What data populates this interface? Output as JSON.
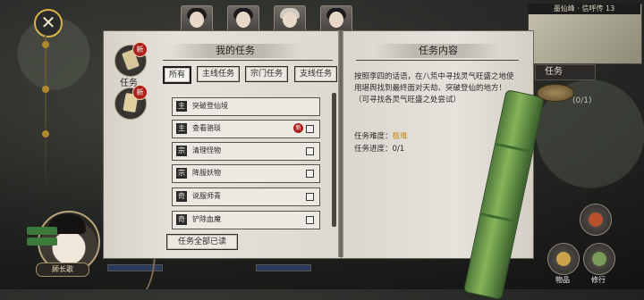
{
  "hud": {
    "close_glyph": "✕",
    "minimap_title": "墨仙峰 · 信呼传 13",
    "side_task_label": "任务",
    "side_text_1": "(0/1)",
    "bottom_buttons": [
      "物品",
      "修行"
    ],
    "player_name": "顾长歌"
  },
  "book": {
    "left": {
      "title": "我的任务",
      "side_tabs": [
        {
          "label": "任务",
          "badge": "新",
          "icon": "scroll-icon"
        },
        {
          "label": "",
          "badge": "新",
          "icon": "letter-icon"
        }
      ],
      "filters": [
        {
          "label": "所有",
          "active": true
        },
        {
          "label": "主线任务",
          "active": false
        },
        {
          "label": "宗门任务",
          "active": false
        },
        {
          "label": "支线任务",
          "active": false
        }
      ],
      "tasks": [
        {
          "type": "主",
          "name": "突破登仙境",
          "new": false,
          "checkbox": false
        },
        {
          "type": "主",
          "name": "查看骆琰",
          "new": true,
          "new_badge": "新",
          "checkbox": true
        },
        {
          "type": "宗",
          "name": "清理怪物",
          "new": false,
          "checkbox": true
        },
        {
          "type": "宗",
          "name": "降服妖物",
          "new": false,
          "checkbox": true
        },
        {
          "type": "奇",
          "name": "说服师青",
          "new": false,
          "checkbox": true
        },
        {
          "type": "奇",
          "name": "铲除血魔",
          "new": false,
          "checkbox": true
        }
      ],
      "read_all_button": "任务全部已读"
    },
    "right": {
      "title": "任务内容",
      "description": "按照李四的话语，在八荒中寻找灵气旺盛之地使用堪舆找到最终面对天劫、突破登仙的地方！（可寻找各灵气旺盛之处尝试）",
      "difficulty_label": "任务难度：",
      "difficulty_value": "极难",
      "progress_label": "任务进度：",
      "progress_value": "0/1"
    }
  },
  "colors": {
    "difficulty": "#c08a18",
    "badge": "#a9201c"
  }
}
